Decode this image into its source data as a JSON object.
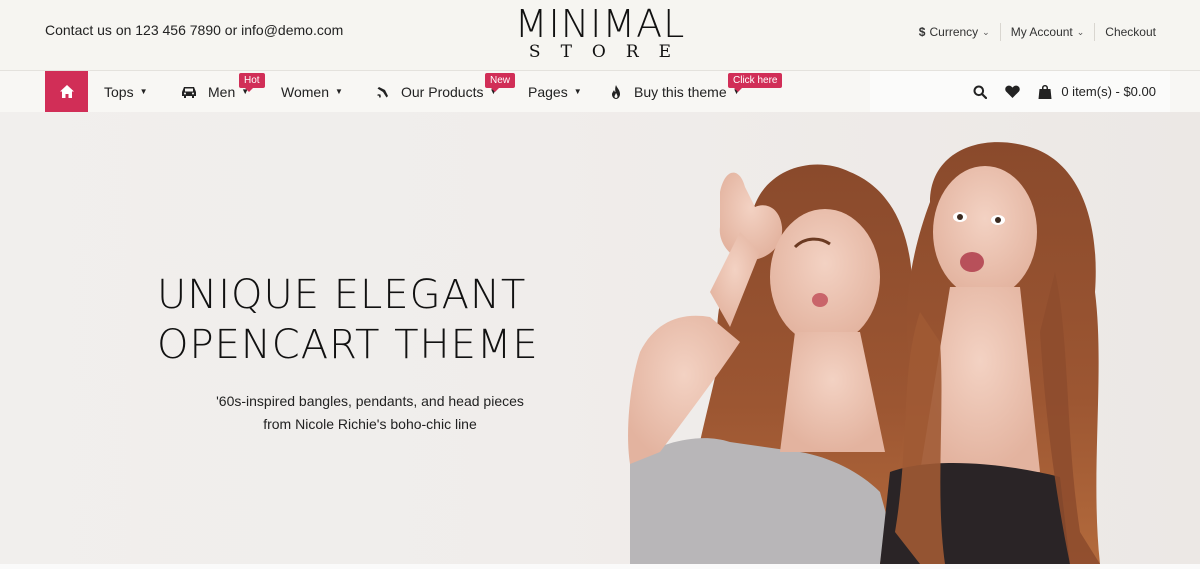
{
  "topbar": {
    "contact": "Contact us on 123 456 7890 or info@demo.com",
    "logo_main": "MINIMAL",
    "logo_sub": "STORE",
    "currency_label": "Currency",
    "currency_symbol": "$",
    "account_label": "My Account",
    "checkout_label": "Checkout"
  },
  "nav": {
    "items": [
      {
        "label": "Tops"
      },
      {
        "label": "Men",
        "badge": "Hot"
      },
      {
        "label": "Women"
      },
      {
        "label": "Our Products",
        "badge": "New"
      },
      {
        "label": "Pages"
      },
      {
        "label": "Buy this theme",
        "badge": "Click here"
      }
    ],
    "cart_label": "0 item(s) - $0.00"
  },
  "hero": {
    "title_line1": "UNIQUE ELEGANT",
    "title_line2": "OPENCART THEME",
    "subtitle_line1": "'60s-inspired bangles, pendants, and head pieces",
    "subtitle_line2": "from Nicole Richie's boho-chic line"
  },
  "colors": {
    "accent": "#d12e57",
    "nav_bg": "#f8f7f4",
    "hero_bg": "#f0edeb"
  },
  "icons": [
    "home-icon",
    "car-icon",
    "plane-icon",
    "flame-icon",
    "search-icon",
    "heart-icon",
    "cart-icon",
    "chevron-down-icon"
  ]
}
